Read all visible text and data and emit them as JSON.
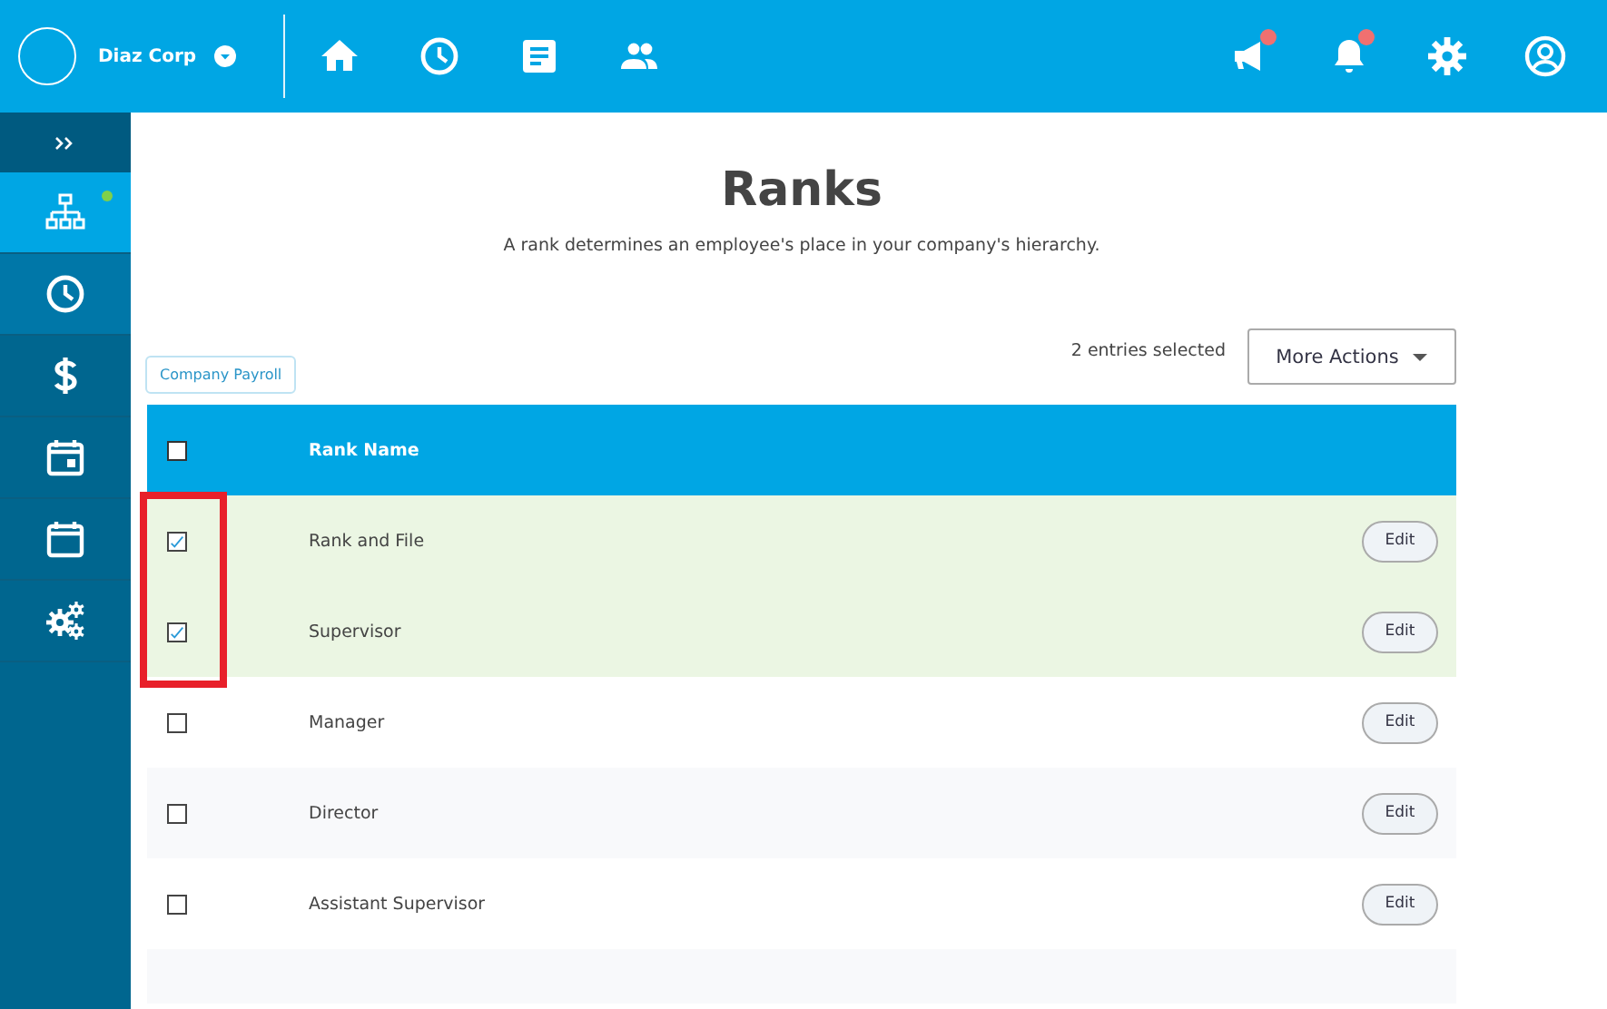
{
  "header": {
    "company": "Diaz Corp",
    "nav": [
      {
        "kind": "home"
      },
      {
        "kind": "clock"
      },
      {
        "kind": "document"
      },
      {
        "kind": "people"
      }
    ],
    "actions": [
      {
        "kind": "megaphone",
        "badge": true
      },
      {
        "kind": "bell",
        "badge": true
      },
      {
        "kind": "settings",
        "badge": false
      },
      {
        "kind": "profile",
        "badge": false
      }
    ]
  },
  "sidebar": {
    "items": [
      {
        "kind": "org-chart",
        "selected": true,
        "dot": true
      },
      {
        "kind": "clock",
        "selected": false,
        "dot": false
      },
      {
        "kind": "dollar",
        "selected": false,
        "dot": false,
        "tooltip": "Company Payroll"
      },
      {
        "kind": "calendar-event",
        "selected": false,
        "dot": false
      },
      {
        "kind": "calendar",
        "selected": false,
        "dot": false
      },
      {
        "kind": "gears",
        "selected": false,
        "dot": false
      }
    ]
  },
  "page": {
    "title": "Ranks",
    "subtitle": "A rank determines an employee's place in your company's hierarchy."
  },
  "toolbar": {
    "selection_count": "2 entries selected",
    "more_actions": "More Actions"
  },
  "table": {
    "columns": [
      "Rank Name"
    ],
    "header_checked": false,
    "rows": [
      {
        "name": "Rank and File",
        "checked": true,
        "action": "Edit"
      },
      {
        "name": "Supervisor",
        "checked": true,
        "action": "Edit"
      },
      {
        "name": "Manager",
        "checked": false,
        "action": "Edit"
      },
      {
        "name": "Director",
        "checked": false,
        "action": "Edit"
      },
      {
        "name": "Assistant Supervisor",
        "checked": false,
        "action": "Edit"
      }
    ]
  }
}
